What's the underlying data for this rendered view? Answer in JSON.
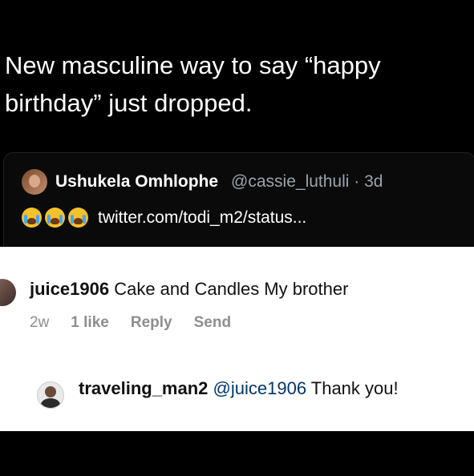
{
  "headline": "New masculine way to say “happy birthday” just dropped.",
  "quoted_tweet": {
    "name": "Ushukela Omhlophe",
    "handle_time": "@cassie_luthuli · 3d",
    "emojis": [
      "loudly-crying-face",
      "loudly-crying-face",
      "loudly-crying-face"
    ],
    "link_text": "twitter.com/todi_m2/status..."
  },
  "comment1": {
    "username": "juice1906",
    "text": " Cake and Candles My brother",
    "meta": {
      "age": "2w",
      "likes": "1 like",
      "reply": "Reply",
      "send": "Send"
    }
  },
  "comment2": {
    "username": "traveling_man2",
    "mention": "@juice1906",
    "text": " Thank you!"
  }
}
